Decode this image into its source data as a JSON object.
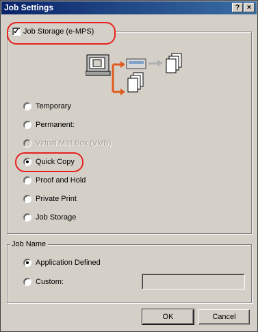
{
  "window": {
    "title": "Job Settings",
    "help_label": "?",
    "close_label": "×"
  },
  "job_storage_group": {
    "checkbox_label": "Job Storage (e-MPS)",
    "checked": true
  },
  "storage_options": [
    {
      "label": "Temporary",
      "selected": false,
      "disabled": false
    },
    {
      "label": "Permanent:",
      "selected": false,
      "disabled": false
    },
    {
      "label": "Virtual Mail Box (VMB)",
      "selected": false,
      "disabled": true
    },
    {
      "label": "Quick Copy",
      "selected": true,
      "disabled": false
    },
    {
      "label": "Proof and Hold",
      "selected": false,
      "disabled": false
    },
    {
      "label": "Private Print",
      "selected": false,
      "disabled": false
    },
    {
      "label": "Job Storage",
      "selected": false,
      "disabled": false
    }
  ],
  "job_name_group": {
    "legend": "Job Name",
    "options": [
      {
        "label": "Application Defined",
        "selected": true
      },
      {
        "label": "Custom:",
        "selected": false
      }
    ],
    "custom_value": ""
  },
  "buttons": {
    "ok_label": "OK",
    "cancel_label": "Cancel"
  },
  "colors": {
    "highlight": "#e8221f",
    "diagram_arrow": "#e05a1e",
    "title_bar": "#0a246a"
  }
}
